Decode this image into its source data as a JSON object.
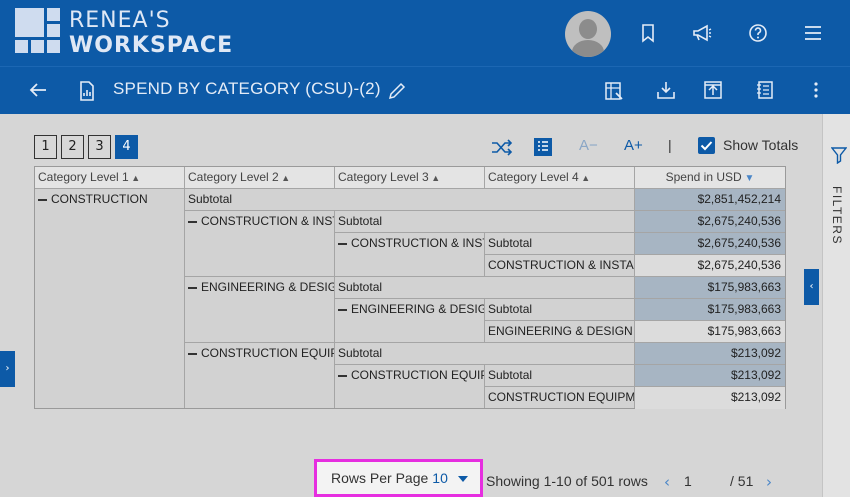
{
  "header": {
    "brand_line1": "RENEA'S",
    "brand_line2": "WORKSPACE"
  },
  "subheader": {
    "title": "SPEND BY CATEGORY (CSU)-(2)"
  },
  "toolbar": {
    "level_buttons": [
      "1",
      "2",
      "3",
      "4"
    ],
    "active_level": "4",
    "font_decrease_label": "A−",
    "font_increase_label": "A+",
    "separator": "|",
    "show_totals_label": "Show Totals",
    "show_totals_checked": true
  },
  "side_panel": {
    "filters_label": "FILTERS"
  },
  "table": {
    "columns": [
      "Category Level 1",
      "Category Level 2",
      "Category Level 3",
      "Category Level 4",
      "Spend in USD"
    ],
    "level1": "CONSTRUCTION",
    "subtotal_label": "Subtotal",
    "groups": {
      "g1_level2": "CONSTRUCTION & INSTALLATION",
      "g1_level3": "CONSTRUCTION & INSTALLATION",
      "g1_level4": "CONSTRUCTION & INSTALLATION",
      "g2_level2": "ENGINEERING & DESIGN",
      "g2_level3": "ENGINEERING & DESIGN",
      "g2_level4": "ENGINEERING & DESIGN",
      "g3_level2": "CONSTRUCTION EQUIPMENT",
      "g3_level3": "CONSTRUCTION EQUIPMENT",
      "g3_level4": "CONSTRUCTION EQUIPMENT"
    },
    "values": [
      "$2,851,452,214",
      "$2,675,240,536",
      "$2,675,240,536",
      "$2,675,240,536",
      "$175,983,663",
      "$175,983,663",
      "$175,983,663",
      "$213,092",
      "$213,092",
      "$213,092"
    ]
  },
  "pagination": {
    "rows_per_page_label": "Rows Per Page",
    "rows_per_page_value": "10",
    "showing_text": "Showing 1-10 of 501 rows",
    "current_page": "1",
    "total_pages": "/ 51"
  },
  "colors": {
    "primary": "#0d5aa7",
    "highlight_border": "#e62ee0"
  }
}
